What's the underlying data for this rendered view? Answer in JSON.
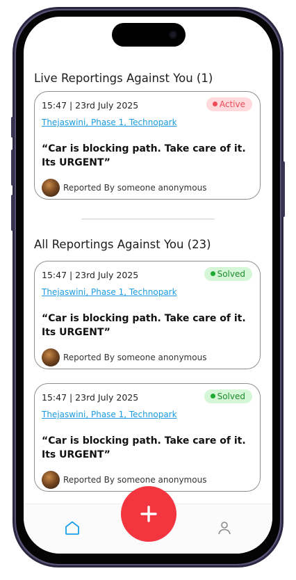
{
  "live_section": {
    "title": "Live Reportings Against You (1)"
  },
  "all_section": {
    "title": "All Reportings Against You (23)"
  },
  "live_reports": [
    {
      "time": "15:47 | 23rd July 2025",
      "status": "Active",
      "location": "Thejaswini, Phase 1, Technopark",
      "message": "“Car is blocking path. Take care of it. Its URGENT”",
      "reporter": "Reported By someone anonymous"
    }
  ],
  "all_reports": [
    {
      "time": "15:47 | 23rd July 2025",
      "status": "Solved",
      "location": "Thejaswini, Phase 1, Technopark",
      "message": "“Car is blocking path. Take care of it. Its URGENT”",
      "reporter": "Reported By someone anonymous"
    },
    {
      "time": "15:47 | 23rd July 2025",
      "status": "Solved",
      "location": "Thejaswini, Phase 1, Technopark",
      "message": "“Car is blocking path. Take care of it. Its URGENT”",
      "reporter": "Reported By someone anonymous"
    }
  ],
  "bottom_nav": {
    "home_icon": "home-icon",
    "add_icon": "plus-icon",
    "profile_icon": "user-icon"
  },
  "colors": {
    "active": "#ef4b57",
    "solved": "#1faa33",
    "link": "#1a9be0",
    "fab": "#f2353f",
    "home_icon": "#1aa0e8"
  }
}
